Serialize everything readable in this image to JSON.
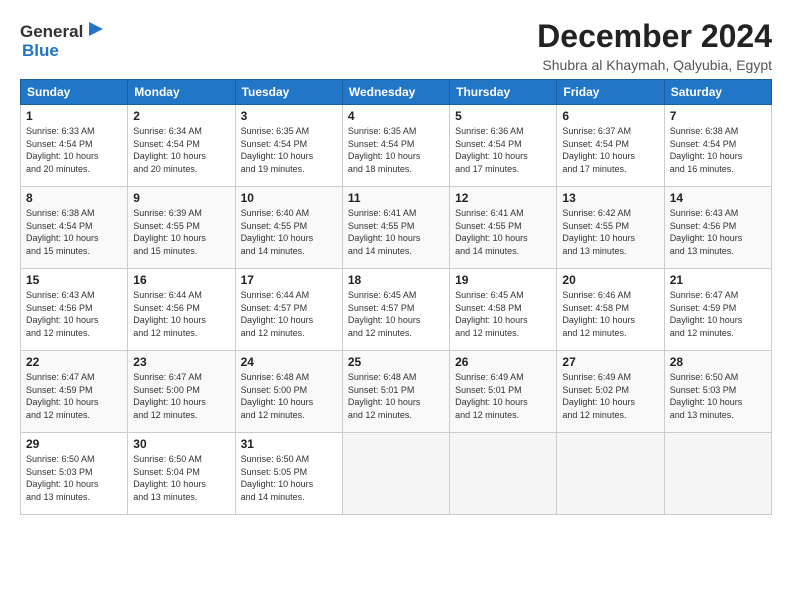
{
  "header": {
    "logo_general": "General",
    "logo_blue": "Blue",
    "title": "December 2024",
    "subtitle": "Shubra al Khaymah, Qalyubia, Egypt"
  },
  "days_of_week": [
    "Sunday",
    "Monday",
    "Tuesday",
    "Wednesday",
    "Thursday",
    "Friday",
    "Saturday"
  ],
  "weeks": [
    [
      {
        "day": "1",
        "sunrise": "6:33 AM",
        "sunset": "4:54 PM",
        "daylight": "10 hours and 20 minutes."
      },
      {
        "day": "2",
        "sunrise": "6:34 AM",
        "sunset": "4:54 PM",
        "daylight": "10 hours and 20 minutes."
      },
      {
        "day": "3",
        "sunrise": "6:35 AM",
        "sunset": "4:54 PM",
        "daylight": "10 hours and 19 minutes."
      },
      {
        "day": "4",
        "sunrise": "6:35 AM",
        "sunset": "4:54 PM",
        "daylight": "10 hours and 18 minutes."
      },
      {
        "day": "5",
        "sunrise": "6:36 AM",
        "sunset": "4:54 PM",
        "daylight": "10 hours and 17 minutes."
      },
      {
        "day": "6",
        "sunrise": "6:37 AM",
        "sunset": "4:54 PM",
        "daylight": "10 hours and 17 minutes."
      },
      {
        "day": "7",
        "sunrise": "6:38 AM",
        "sunset": "4:54 PM",
        "daylight": "10 hours and 16 minutes."
      }
    ],
    [
      {
        "day": "8",
        "sunrise": "6:38 AM",
        "sunset": "4:54 PM",
        "daylight": "10 hours and 15 minutes."
      },
      {
        "day": "9",
        "sunrise": "6:39 AM",
        "sunset": "4:55 PM",
        "daylight": "10 hours and 15 minutes."
      },
      {
        "day": "10",
        "sunrise": "6:40 AM",
        "sunset": "4:55 PM",
        "daylight": "10 hours and 14 minutes."
      },
      {
        "day": "11",
        "sunrise": "6:41 AM",
        "sunset": "4:55 PM",
        "daylight": "10 hours and 14 minutes."
      },
      {
        "day": "12",
        "sunrise": "6:41 AM",
        "sunset": "4:55 PM",
        "daylight": "10 hours and 14 minutes."
      },
      {
        "day": "13",
        "sunrise": "6:42 AM",
        "sunset": "4:55 PM",
        "daylight": "10 hours and 13 minutes."
      },
      {
        "day": "14",
        "sunrise": "6:43 AM",
        "sunset": "4:56 PM",
        "daylight": "10 hours and 13 minutes."
      }
    ],
    [
      {
        "day": "15",
        "sunrise": "6:43 AM",
        "sunset": "4:56 PM",
        "daylight": "10 hours and 12 minutes."
      },
      {
        "day": "16",
        "sunrise": "6:44 AM",
        "sunset": "4:56 PM",
        "daylight": "10 hours and 12 minutes."
      },
      {
        "day": "17",
        "sunrise": "6:44 AM",
        "sunset": "4:57 PM",
        "daylight": "10 hours and 12 minutes."
      },
      {
        "day": "18",
        "sunrise": "6:45 AM",
        "sunset": "4:57 PM",
        "daylight": "10 hours and 12 minutes."
      },
      {
        "day": "19",
        "sunrise": "6:45 AM",
        "sunset": "4:58 PM",
        "daylight": "10 hours and 12 minutes."
      },
      {
        "day": "20",
        "sunrise": "6:46 AM",
        "sunset": "4:58 PM",
        "daylight": "10 hours and 12 minutes."
      },
      {
        "day": "21",
        "sunrise": "6:47 AM",
        "sunset": "4:59 PM",
        "daylight": "10 hours and 12 minutes."
      }
    ],
    [
      {
        "day": "22",
        "sunrise": "6:47 AM",
        "sunset": "4:59 PM",
        "daylight": "10 hours and 12 minutes."
      },
      {
        "day": "23",
        "sunrise": "6:47 AM",
        "sunset": "5:00 PM",
        "daylight": "10 hours and 12 minutes."
      },
      {
        "day": "24",
        "sunrise": "6:48 AM",
        "sunset": "5:00 PM",
        "daylight": "10 hours and 12 minutes."
      },
      {
        "day": "25",
        "sunrise": "6:48 AM",
        "sunset": "5:01 PM",
        "daylight": "10 hours and 12 minutes."
      },
      {
        "day": "26",
        "sunrise": "6:49 AM",
        "sunset": "5:01 PM",
        "daylight": "10 hours and 12 minutes."
      },
      {
        "day": "27",
        "sunrise": "6:49 AM",
        "sunset": "5:02 PM",
        "daylight": "10 hours and 12 minutes."
      },
      {
        "day": "28",
        "sunrise": "6:50 AM",
        "sunset": "5:03 PM",
        "daylight": "10 hours and 13 minutes."
      }
    ],
    [
      {
        "day": "29",
        "sunrise": "6:50 AM",
        "sunset": "5:03 PM",
        "daylight": "10 hours and 13 minutes."
      },
      {
        "day": "30",
        "sunrise": "6:50 AM",
        "sunset": "5:04 PM",
        "daylight": "10 hours and 13 minutes."
      },
      {
        "day": "31",
        "sunrise": "6:50 AM",
        "sunset": "5:05 PM",
        "daylight": "10 hours and 14 minutes."
      },
      null,
      null,
      null,
      null
    ]
  ],
  "labels": {
    "sunrise": "Sunrise:",
    "sunset": "Sunset:",
    "daylight": "Daylight:"
  }
}
